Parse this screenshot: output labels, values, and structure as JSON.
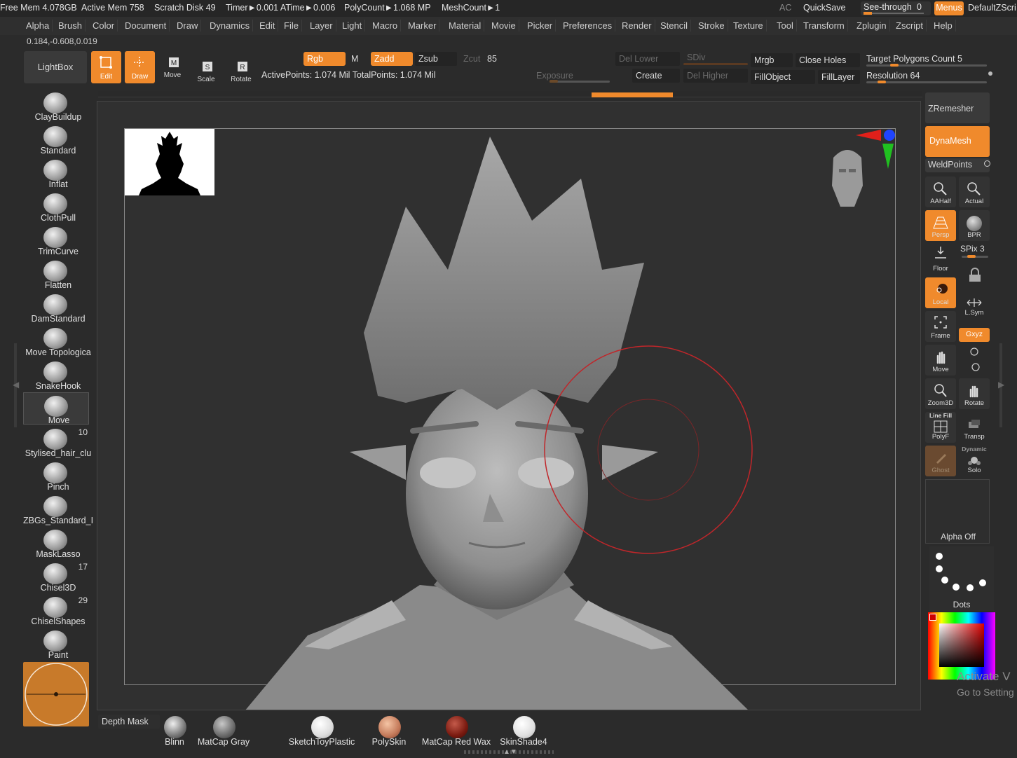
{
  "status": {
    "free_mem": "Free Mem 4.078GB",
    "active_mem": "Active Mem 758",
    "scratch_disk": "Scratch Disk 49",
    "timer": "Timer►0.001 ATime►0.006",
    "polycount": "PolyCount►1.068 MP",
    "meshcount": "MeshCount►1",
    "ac": "AC",
    "quicksave": "QuickSave",
    "see_through_label": "See-through",
    "see_through_value": "0",
    "menus": "Menus",
    "default_script": "DefaultZScri"
  },
  "menu": [
    "Alpha",
    "Brush",
    "Color",
    "Document",
    "Draw",
    "Dynamics",
    "Edit",
    "File",
    "Layer",
    "Light",
    "Macro",
    "Marker",
    "Material",
    "Movie",
    "Picker",
    "Preferences",
    "Render",
    "Stencil",
    "Stroke",
    "Texture",
    "Tool",
    "Transform",
    "Zplugin",
    "Zscript",
    "Help"
  ],
  "coords": "0.184,-0.608,0.019",
  "toolbar": {
    "lightbox": "LightBox",
    "edit": "Edit",
    "draw": "Draw",
    "move": "Move",
    "scale": "Scale",
    "rotate": "Rotate",
    "rgb": "Rgb",
    "m": "M",
    "zadd": "Zadd",
    "zsub": "Zsub",
    "zcut": "Zcut",
    "zcut_value": "85",
    "points": "ActivePoints: 1.074 Mil TotalPoints: 1.074 Mil",
    "del_lower": "Del Lower",
    "sdiv": "SDiv",
    "exposure": "Exposure",
    "create": "Create",
    "del_higher": "Del Higher",
    "mrgb": "Mrgb",
    "close_holes": "Close Holes",
    "fill_object": "FillObject",
    "fill_layer": "FillLayer",
    "target_polygons": "Target Polygons Count 5",
    "resolution": "Resolution 64"
  },
  "brushes": [
    {
      "label": "ClayBuildup",
      "count": ""
    },
    {
      "label": "Standard",
      "count": ""
    },
    {
      "label": "Inflat",
      "count": ""
    },
    {
      "label": "ClothPull",
      "count": ""
    },
    {
      "label": "TrimCurve",
      "count": ""
    },
    {
      "label": "Flatten",
      "count": ""
    },
    {
      "label": "DamStandard",
      "count": ""
    },
    {
      "label": "Move Topologica",
      "count": ""
    },
    {
      "label": "SnakeHook",
      "count": ""
    },
    {
      "label": "Move",
      "count": ""
    },
    {
      "label": "Stylised_hair_clu",
      "count": "10"
    },
    {
      "label": "Pinch",
      "count": ""
    },
    {
      "label": "ZBGs_Standard_I",
      "count": ""
    },
    {
      "label": "MaskLasso",
      "count": ""
    },
    {
      "label": "Chisel3D",
      "count": "17"
    },
    {
      "label": "ChiselShapes",
      "count": "29"
    },
    {
      "label": "Paint",
      "count": ""
    }
  ],
  "right": {
    "zremesher": "ZRemesher",
    "dynamesh": "DynaMesh",
    "weldpoints": "WeldPoints",
    "aahalf": "AAHalf",
    "actual": "Actual",
    "persp": "Persp",
    "bpr": "BPR",
    "spix": "SPix 3",
    "floor": "Floor",
    "local": "Local",
    "lsym": "L.Sym",
    "frame": "Frame",
    "xyz": "Gxyz",
    "move": "Move",
    "zoom3d": "Zoom3D",
    "rotate": "Rotate",
    "line_fill": "Line Fill",
    "polyf": "PolyF",
    "transp": "Transp",
    "ghost": "Ghost",
    "dynamic": "Dynamic",
    "solo": "Solo",
    "alpha_off": "Alpha Off",
    "dots": "Dots",
    "activate_1": "Activate V",
    "activate_2": "Go to Setting"
  },
  "bottom": {
    "depth_mask": "Depth Mask",
    "materials": [
      "Blinn",
      "MatCap Gray",
      "SketchToyPlastic",
      "PolySkin",
      "MatCap Red Wax",
      "SkinShade4"
    ]
  },
  "colors": {
    "accent": "#f08a2c",
    "panel": "#2b2b2b",
    "brush_circle": "#c0262a"
  }
}
